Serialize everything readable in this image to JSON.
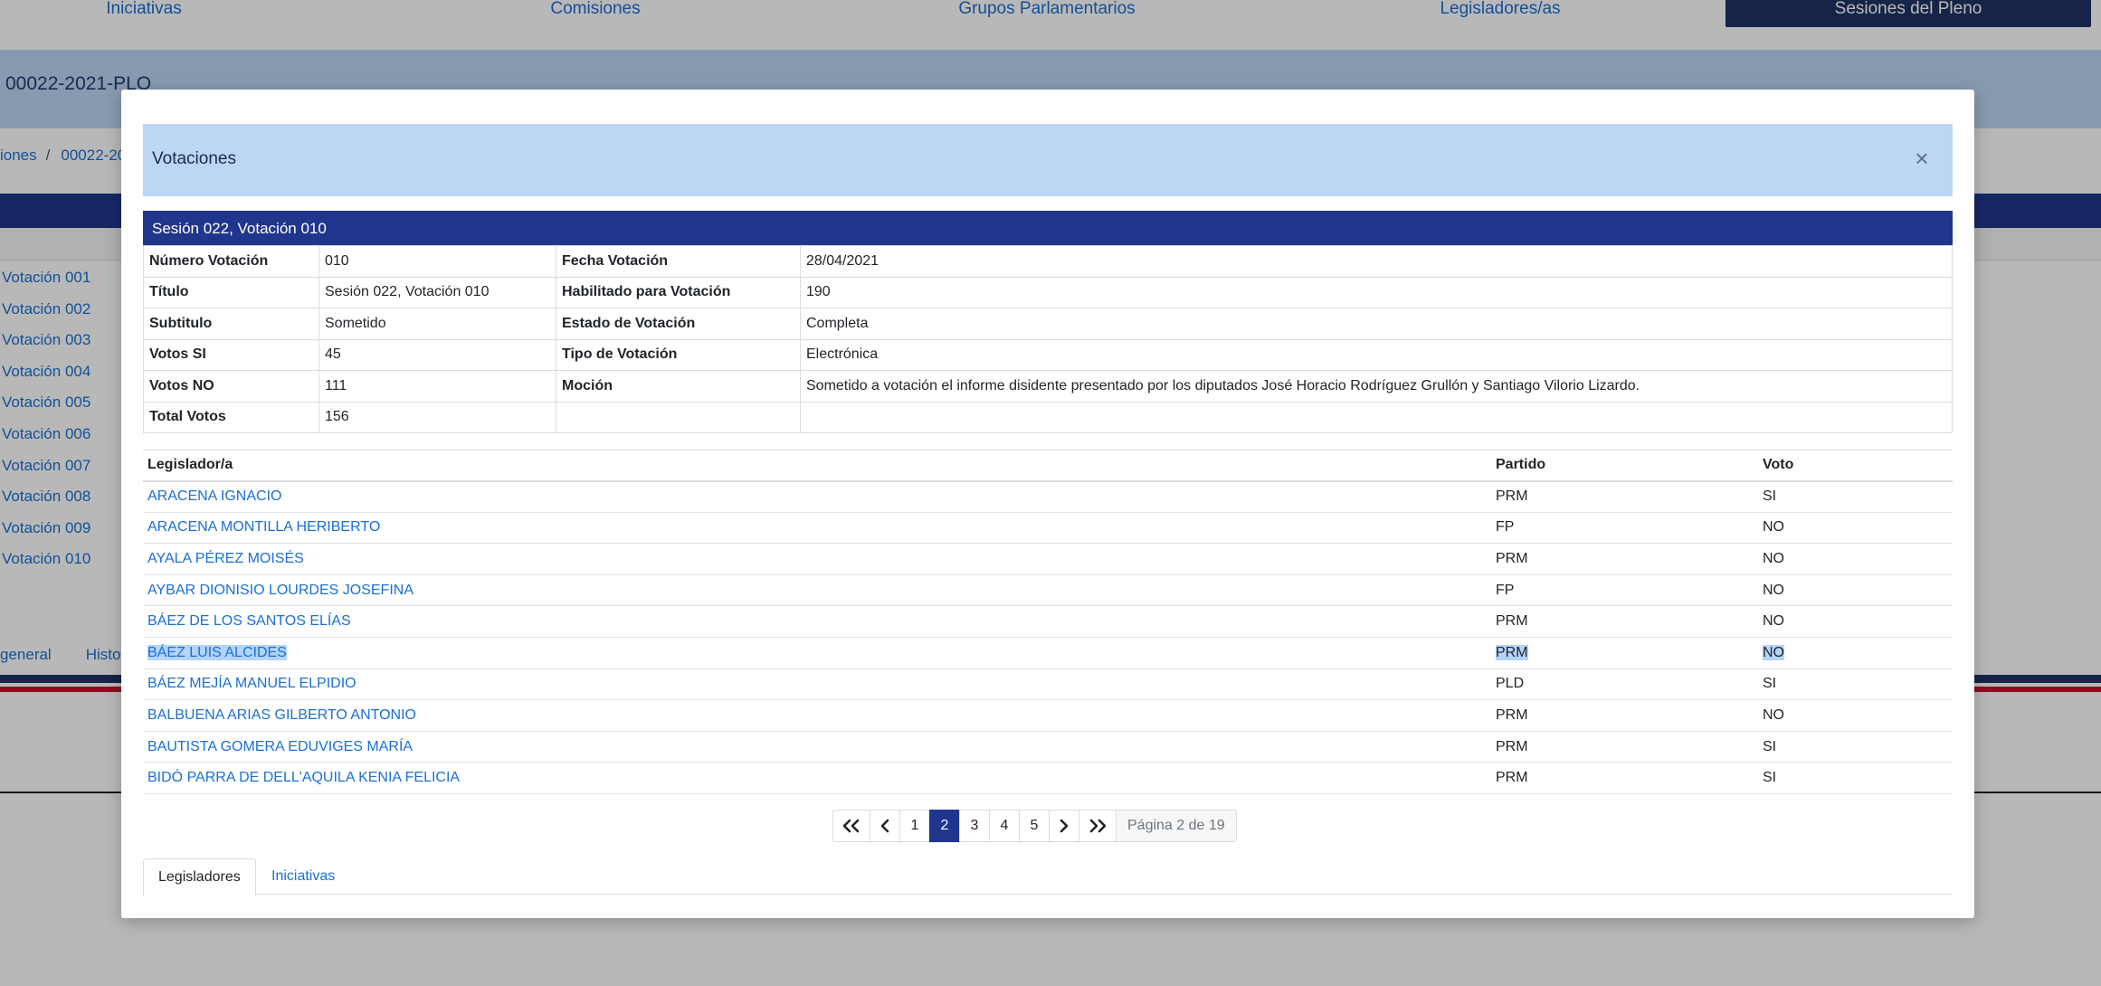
{
  "nav": {
    "items": [
      "Iniciativas",
      "Comisiones",
      "Grupos Parlamentarios",
      "Legisladores/as",
      "Sesiones del Pleno"
    ]
  },
  "page": {
    "code": "00022-2021-PLO",
    "breadcrumb": [
      "iones",
      "00022-20"
    ],
    "votes": [
      "Votación 001",
      "Votación 002",
      "Votación 003",
      "Votación 004",
      "Votación 005",
      "Votación 006",
      "Votación 007",
      "Votación 008",
      "Votación 009",
      "Votación 010"
    ],
    "bottom_tabs": [
      "general",
      "Histori"
    ]
  },
  "modal": {
    "title": "Votaciones",
    "close": "×",
    "session_title": "Sesión 022, Votación 010",
    "info": {
      "numero_votacion_label": "Número Votación",
      "numero_votacion": "010",
      "fecha_votacion_label": "Fecha Votación",
      "fecha_votacion": "28/04/2021",
      "titulo_label": "Título",
      "titulo": "Sesión 022, Votación 010",
      "habilitado_label": "Habilitado para Votación",
      "habilitado": "190",
      "subtitulo_label": "Subtitulo",
      "subtitulo": "Sometido",
      "estado_label": "Estado de Votación",
      "estado": "Completa",
      "votos_si_label": "Votos SI",
      "votos_si": "45",
      "tipo_label": "Tipo de Votación",
      "tipo": "Electrónica",
      "votos_no_label": "Votos NO",
      "votos_no": "111",
      "mocion_label": "Moción",
      "mocion": "Sometido a votación el informe disidente presentado por los diputados José Horacio Rodríguez Grullón y Santiago Vilorio Lizardo.",
      "total_label": "Total Votos",
      "total": "156"
    },
    "table": {
      "headers": [
        "Legislador/a",
        "Partido",
        "Voto"
      ],
      "rows": [
        {
          "name": "ARACENA IGNACIO",
          "party": "PRM",
          "vote": "SI"
        },
        {
          "name": "ARACENA MONTILLA HERIBERTO",
          "party": "FP",
          "vote": "NO"
        },
        {
          "name": "AYALA PÉREZ MOISÉS",
          "party": "PRM",
          "vote": "NO"
        },
        {
          "name": "AYBAR DIONISIO LOURDES JOSEFINA",
          "party": "FP",
          "vote": "NO"
        },
        {
          "name": "BÁEZ DE LOS SANTOS ELÍAS",
          "party": "PRM",
          "vote": "NO"
        },
        {
          "name": "BÁEZ LUIS ALCIDES",
          "party": "PRM",
          "vote": "NO"
        },
        {
          "name": "BÁEZ MEJÍA MANUEL ELPIDIO",
          "party": "PLD",
          "vote": "SI"
        },
        {
          "name": "BALBUENA ARIAS GILBERTO ANTONIO",
          "party": "PRM",
          "vote": "NO"
        },
        {
          "name": "BAUTISTA GOMERA EDUVIGES MARÍA",
          "party": "PRM",
          "vote": "SI"
        },
        {
          "name": "BIDÓ PARRA DE DELL'AQUILA KENIA FELICIA",
          "party": "PRM",
          "vote": "SI"
        }
      ]
    },
    "pagination": {
      "pages": [
        "1",
        "2",
        "3",
        "4",
        "5"
      ],
      "current": "2",
      "info": "Página 2 de 19"
    },
    "tabs": [
      "Legisladores",
      "Iniciativas"
    ]
  }
}
